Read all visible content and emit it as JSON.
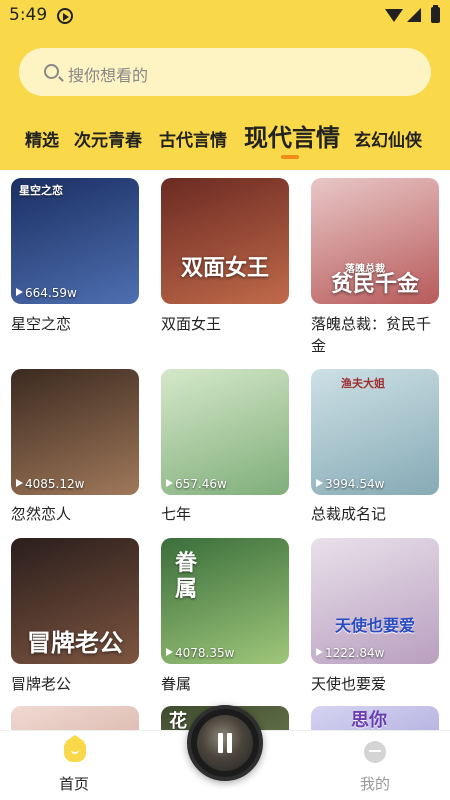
{
  "status": {
    "time": "5:49"
  },
  "search": {
    "placeholder": "搜你想看的"
  },
  "tabs": [
    {
      "label": "精选",
      "active": false
    },
    {
      "label": "次元青春",
      "active": false
    },
    {
      "label": "古代言情",
      "active": false
    },
    {
      "label": "现代言情",
      "active": true
    },
    {
      "label": "玄幻仙侠",
      "active": false
    }
  ],
  "books": [
    {
      "title": "星空之恋",
      "plays": "664.59w",
      "cover_text": "星空之恋",
      "cover_colors": [
        "#1b2f63",
        "#4e6fb0"
      ]
    },
    {
      "title": "双面女王",
      "plays": "",
      "cover_text": "双面女王",
      "cover_colors": [
        "#6b2a22",
        "#c06a4a"
      ]
    },
    {
      "title": "落魄总裁：贫民千金",
      "plays": "",
      "cover_text": "贫民千金",
      "cover_top": "落魄总裁",
      "cover_colors": [
        "#e8c7c7",
        "#b85a5a"
      ]
    },
    {
      "title": "忽然恋人",
      "plays": "4085.12w",
      "cover_text": "",
      "cover_colors": [
        "#3b2a20",
        "#a0785a"
      ]
    },
    {
      "title": "七年",
      "plays": "657.46w",
      "cover_text": "",
      "cover_colors": [
        "#d5e8c9",
        "#7fae7a"
      ]
    },
    {
      "title": "总裁成名记",
      "plays": "3994.54w",
      "cover_text": "",
      "cover_top": "渔夫大姐",
      "cover_colors": [
        "#cde0e6",
        "#86aab4"
      ]
    },
    {
      "title": "冒牌老公",
      "plays": "",
      "cover_text": "冒牌老公",
      "cover_colors": [
        "#2a1e1c",
        "#7d5540"
      ]
    },
    {
      "title": "眷属",
      "plays": "4078.35w",
      "cover_text": "",
      "cover_top": "眷属",
      "cover_colors": [
        "#3a6e3a",
        "#9fc77b"
      ]
    },
    {
      "title": "天使也要爱",
      "plays": "1222.84w",
      "cover_text": "天使也要爱",
      "cover_colors": [
        "#e9e0ea",
        "#b89fbf"
      ]
    },
    {
      "title": "",
      "plays": "",
      "cover_text": "",
      "cover_colors": [
        "#f0d9d2",
        "#c69a8c"
      ]
    },
    {
      "title": "",
      "plays": "",
      "cover_text": "",
      "cover_top": "花",
      "cover_colors": [
        "#3e4c2e",
        "#8f9d6a"
      ]
    },
    {
      "title": "",
      "plays": "",
      "cover_text": "",
      "cover_top": "思你",
      "cover_colors": [
        "#d6d4f0",
        "#8e8ad0"
      ]
    }
  ],
  "tabbar": {
    "home": "首页",
    "mine": "我的"
  },
  "colors": {
    "header": "#f9d94a",
    "indicator": "#f08c1a",
    "search_bg": "#fdf3c3"
  }
}
